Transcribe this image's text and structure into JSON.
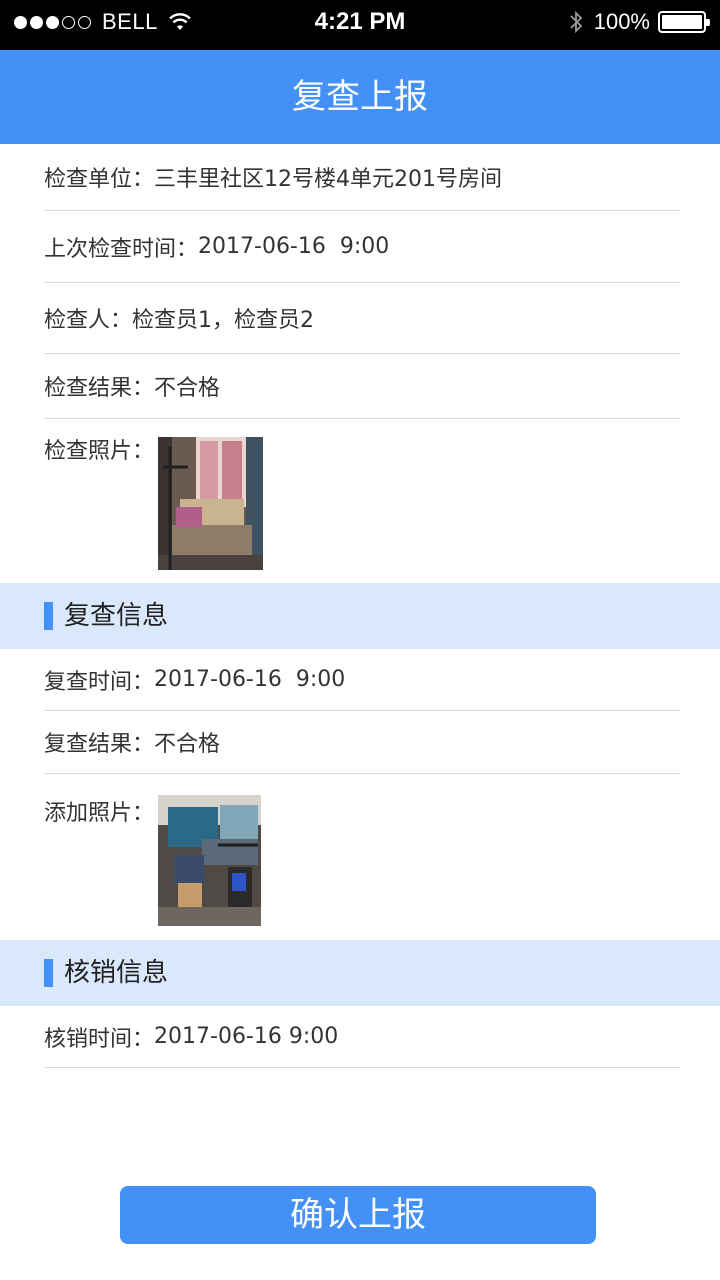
{
  "status_bar": {
    "carrier": "BELL",
    "time": "4:21 PM",
    "battery": "100%"
  },
  "nav": {
    "title": "复查上报"
  },
  "inspection": {
    "unit_label": "检查单位：",
    "unit_value": "三丰里社区12号楼4单元201号房间",
    "last_time_label": "上次检查时间：",
    "last_time_value": "2017-06-16  9:00",
    "inspector_label": "检查人：",
    "inspector_value": "检查员1，检查员2",
    "result_label": "检查结果：",
    "result_value": "不合格",
    "photo_label": "检查照片："
  },
  "recheck": {
    "section_title": "复查信息",
    "time_label": "复查时间：",
    "time_value": "2017-06-16  9:00",
    "result_label": "复查结果：",
    "result_value": "不合格",
    "photo_label": "添加照片："
  },
  "writeoff": {
    "section_title": "核销信息",
    "time_label": "核销时间：",
    "time_value": "2017-06-16 9:00"
  },
  "confirm_button": "确认上报",
  "colors": {
    "accent": "#4390f6",
    "section_bg": "#d9e8fb",
    "divider": "#dcdcdc",
    "text": "#333333"
  },
  "icons": [
    "wifi-icon",
    "bluetooth-icon",
    "battery-icon"
  ]
}
